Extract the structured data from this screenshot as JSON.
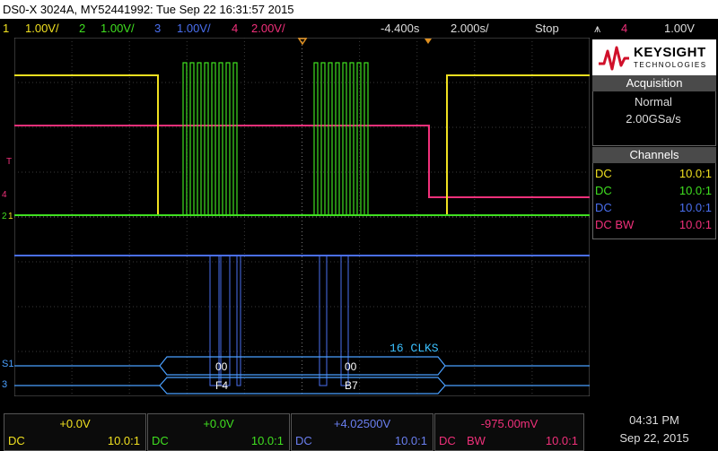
{
  "title": "DS0-X 3024A, MY52441992: Tue Sep 22 16:31:57 2015",
  "channels": [
    {
      "num": "1",
      "scale": "1.00V/",
      "color": "#f0e020"
    },
    {
      "num": "2",
      "scale": "1.00V/",
      "color": "#40e020"
    },
    {
      "num": "3",
      "scale": "1.00V/",
      "color": "#4a6ff0"
    },
    {
      "num": "4",
      "scale": "2.00V/",
      "color": "#f0307a"
    }
  ],
  "timebase": {
    "delay": "-4.400s",
    "scale": "2.000s/",
    "run_state": "Stop"
  },
  "trigger": {
    "icon": "trigger-edge-icon",
    "source": "4",
    "level": "1.00V"
  },
  "panel": {
    "brand_line1": "KEYSIGHT",
    "brand_line2": "TECHNOLOGIES",
    "acq_title": "Acquisition",
    "acq_mode": "Normal",
    "acq_rate": "2.00GSa/s",
    "ch_title": "Channels",
    "rows": [
      {
        "coupling": "DC",
        "ratio": "10.0:1",
        "color": "#f0e020"
      },
      {
        "coupling": "DC",
        "ratio": "10.0:1",
        "color": "#40e020"
      },
      {
        "coupling": "DC",
        "ratio": "10.0:1",
        "color": "#4a6ff0"
      },
      {
        "coupling": "DC BW",
        "ratio": "10.0:1",
        "color": "#f0307a"
      }
    ]
  },
  "markers": {
    "t": "T",
    "ch4": "4",
    "ch1": "1",
    "ch2": "2",
    "s1": "S1",
    "s3": "3"
  },
  "serial": {
    "clk_label": "16  CLKS",
    "s1_a": "00",
    "s1_b": "00",
    "s3_a": "F4",
    "s3_b": "B7"
  },
  "bottom": [
    {
      "offset": "+0.0V",
      "coupling": "DC",
      "bw": "",
      "probe": "10.0:1",
      "color": "#f0e020"
    },
    {
      "offset": "+0.0V",
      "coupling": "DC",
      "bw": "",
      "probe": "10.0:1",
      "color": "#40e020"
    },
    {
      "offset": "+4.02500V",
      "coupling": "DC",
      "bw": "",
      "probe": "10.0:1",
      "color": "#6a7ff0"
    },
    {
      "offset": "-975.00mV",
      "coupling": "DC",
      "bw": "BW",
      "probe": "10.0:1",
      "color": "#f0307a"
    }
  ],
  "clock": {
    "time": "04:31 PM",
    "date": "Sep 22, 2015"
  }
}
